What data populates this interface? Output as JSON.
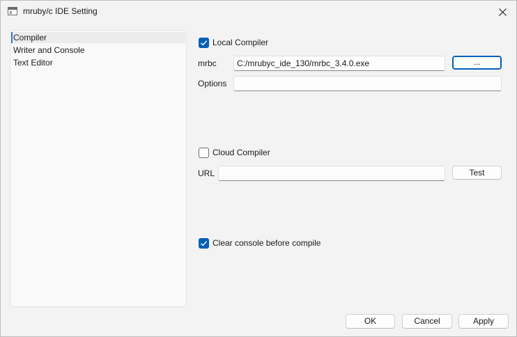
{
  "window": {
    "title": "mruby/c IDE Setting",
    "icon": "window-app-icon",
    "close_icon": "close-icon"
  },
  "nav": {
    "items": [
      {
        "label": "Compiler",
        "selected": true
      },
      {
        "label": "Writer and Console",
        "selected": false
      },
      {
        "label": "Text Editor",
        "selected": false
      }
    ]
  },
  "compiler": {
    "local": {
      "label": "Local Compiler",
      "checked": true,
      "mrbc_label": "mrbc",
      "mrbc_value": "C:/mrubyc_ide_130/mrbc_3.4.0.exe",
      "browse_label": "...",
      "options_label": "Options",
      "options_value": ""
    },
    "cloud": {
      "label": "Cloud Compiler",
      "checked": false,
      "url_label": "URL",
      "url_value": "",
      "test_label": "Test"
    },
    "clear_console": {
      "label": "Clear console before compile",
      "checked": true
    }
  },
  "footer": {
    "ok_label": "OK",
    "cancel_label": "Cancel",
    "apply_label": "Apply"
  },
  "colors": {
    "accent": "#005fb8",
    "background": "#f3f3f3"
  }
}
